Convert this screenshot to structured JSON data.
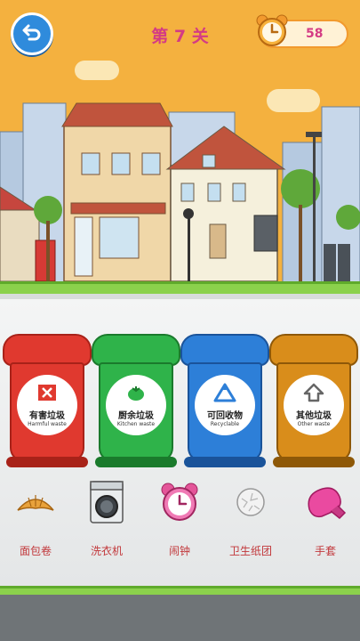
{
  "header": {
    "level_title": "第 7 关",
    "timer_value": "58"
  },
  "bins": [
    {
      "name_cn": "有害垃圾",
      "name_en": "Harmful waste",
      "color": "#e0392f",
      "dark": "#a82219",
      "icon": "harmful-icon"
    },
    {
      "name_cn": "厨余垃圾",
      "name_en": "Kitchen waste",
      "color": "#2fb34a",
      "dark": "#1a7a2c",
      "icon": "kitchen-icon"
    },
    {
      "name_cn": "可回收物",
      "name_en": "Recyclable",
      "color": "#2d7fd8",
      "dark": "#1a539a",
      "icon": "recycle-icon"
    },
    {
      "name_cn": "其他垃圾",
      "name_en": "Other waste",
      "color": "#d98d1b",
      "dark": "#8e5808",
      "icon": "other-icon"
    }
  ],
  "items": [
    {
      "label": "面包卷",
      "icon": "croissant-icon"
    },
    {
      "label": "洗衣机",
      "icon": "washing-machine-icon"
    },
    {
      "label": "闹钟",
      "icon": "alarm-clock-icon"
    },
    {
      "label": "卫生纸团",
      "icon": "tissue-ball-icon"
    },
    {
      "label": "手套",
      "icon": "glove-icon"
    }
  ],
  "colors": {
    "sky": "#f4b13f",
    "grass": "#8bd14c",
    "accent": "#d43b84"
  }
}
